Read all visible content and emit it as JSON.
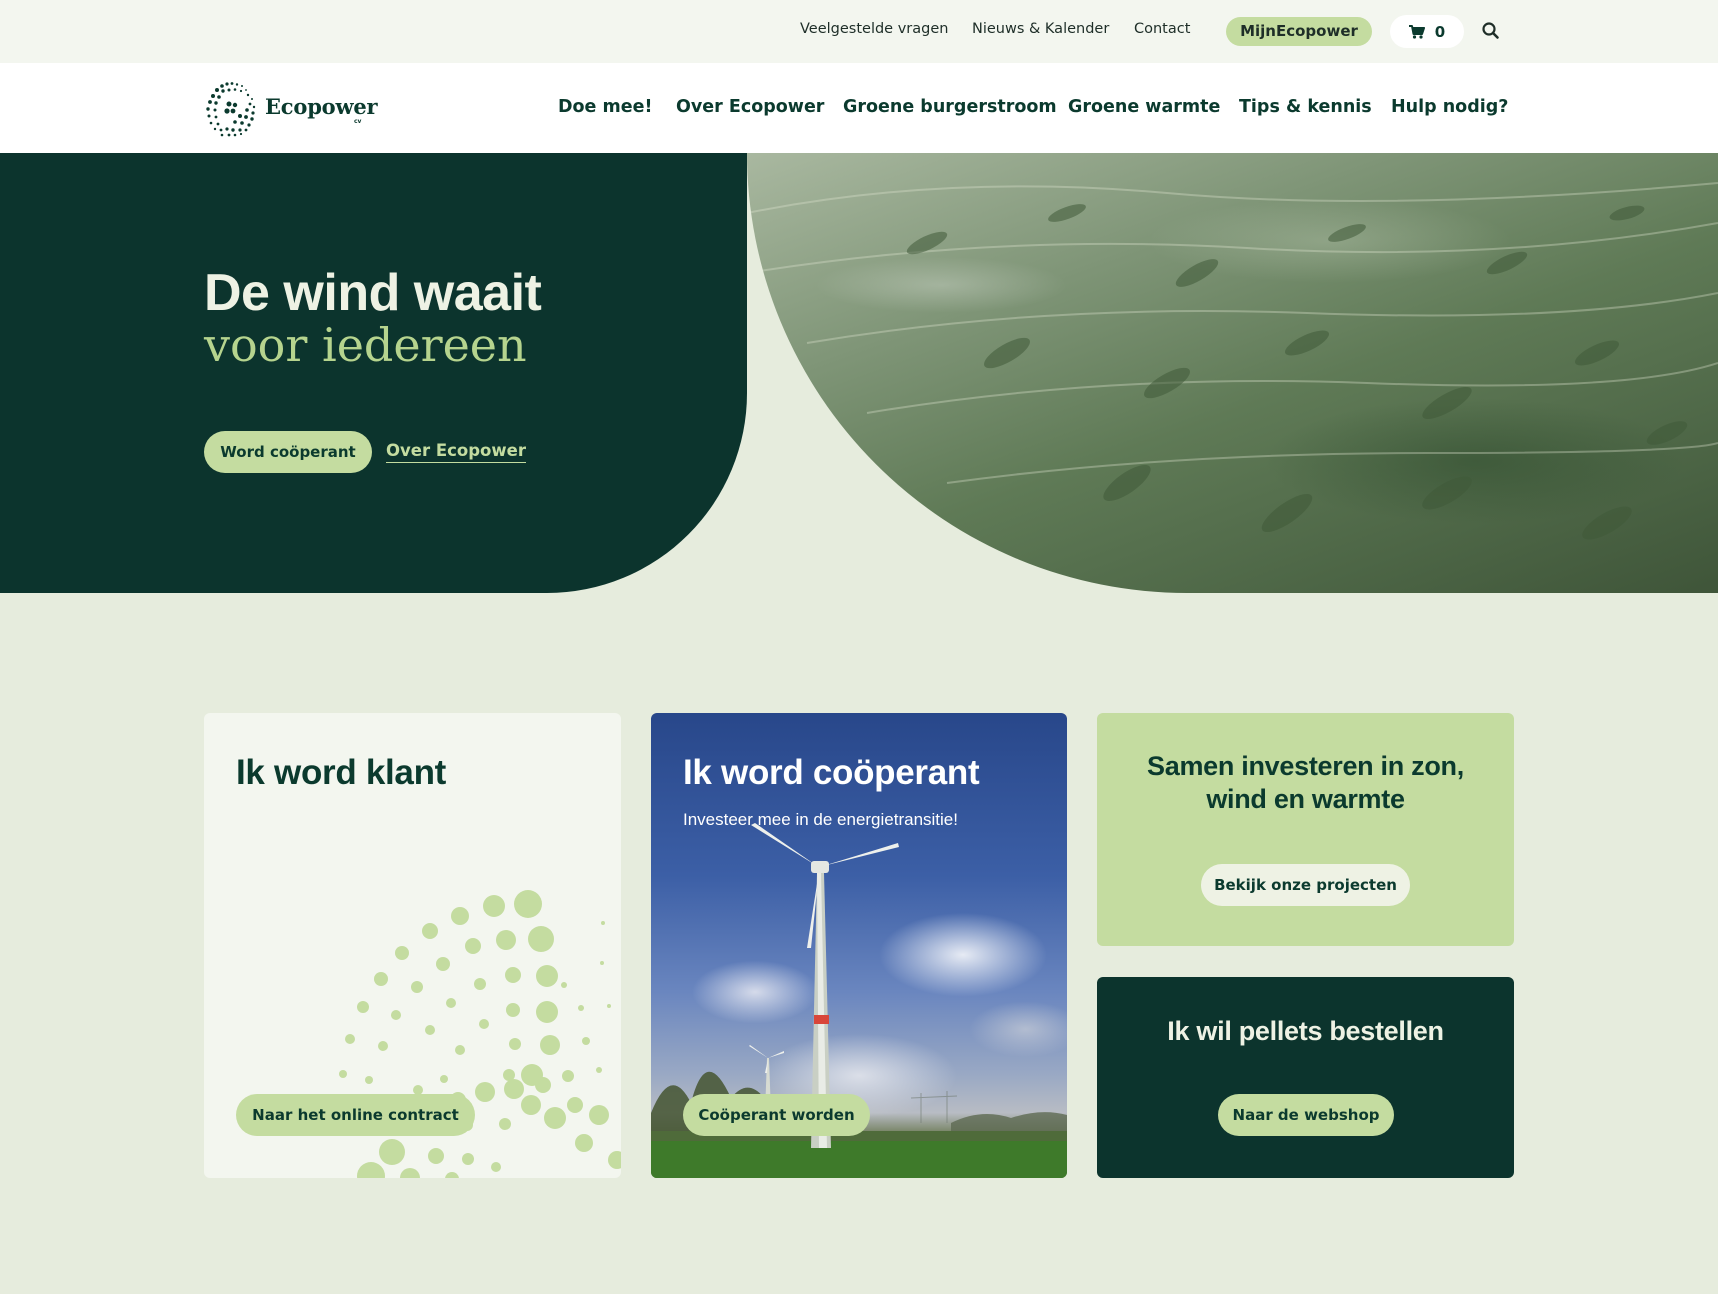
{
  "topbar": {
    "faq": "Veelgestelde vragen",
    "news": "Nieuws & Kalender",
    "contact": "Contact",
    "account": "MijnEcopower",
    "cart_count": "0",
    "cart_icon": "cart-icon",
    "search_icon": "search-icon"
  },
  "brand": {
    "name": "Ecopower",
    "suffix": "cv"
  },
  "nav": {
    "items": [
      "Doe mee!",
      "Over Ecopower",
      "Groene burgerstroom",
      "Groene warmte",
      "Tips & kennis",
      "Hulp nodig?"
    ]
  },
  "hero": {
    "title": "De wind waait",
    "subtitle": "voor iedereen",
    "primary_cta": "Word coöperant",
    "secondary_cta": "Over Ecopower"
  },
  "cards": {
    "klant": {
      "title": "Ik word klant",
      "cta": "Naar het online contract"
    },
    "cooperant": {
      "title": "Ik word coöperant",
      "text": "Investeer mee in de energietransitie!",
      "cta": "Coöperant worden"
    },
    "invest": {
      "title": "Samen investeren in zon, wind en warmte",
      "cta": "Bekijk onze projecten"
    },
    "pellets": {
      "title": "Ik wil pellets bestellen",
      "cta": "Naar de webshop"
    }
  },
  "colors": {
    "dark_green": "#0c342d",
    "light_green": "#c4dca0",
    "page_bg": "#e6ecdd",
    "card_light": "#f3f6ef"
  }
}
